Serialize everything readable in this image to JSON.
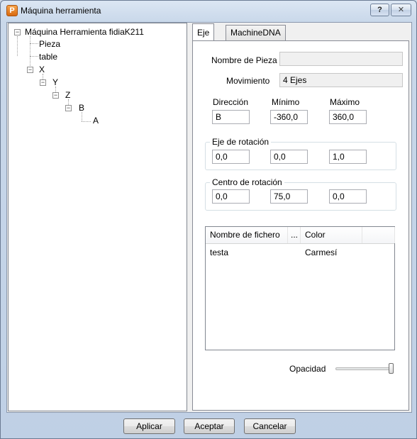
{
  "window": {
    "title": "Máquina herramienta",
    "icon": "app-p-icon",
    "help_label": "?",
    "close_label": "✕"
  },
  "tree": {
    "root": "Máquina Herramienta fidiaK211",
    "items": [
      "Pieza",
      "table",
      "X",
      "Y",
      "Z",
      "B",
      "A"
    ]
  },
  "tabs": [
    {
      "label": "Eje"
    },
    {
      "label": "MachineDNA"
    }
  ],
  "form": {
    "nombre_pieza_label": "Nombre de Pieza",
    "nombre_pieza_value": "",
    "movimiento_label": "Movimiento",
    "movimiento_value": "4 Ejes",
    "direccion_label": "Dirección",
    "minimo_label": "Mínimo",
    "maximo_label": "Máximo",
    "direccion_value": "B",
    "minimo_value": "-360,0",
    "maximo_value": "360,0",
    "eje_rotacion_title": "Eje de rotación",
    "eje_rotacion": [
      "0,0",
      "0,0",
      "1,0"
    ],
    "centro_rotacion_title": "Centro de rotación",
    "centro_rotacion": [
      "0,0",
      "75,0",
      "0,0"
    ]
  },
  "file_list": {
    "columns": [
      "Nombre de fichero",
      "...",
      "Color"
    ],
    "rows": [
      {
        "name": "testa",
        "color": "Carmesí"
      }
    ]
  },
  "opacity": {
    "label": "Opacidad",
    "value": 1.0
  },
  "buttons": {
    "apply": "Aplicar",
    "accept": "Aceptar",
    "cancel": "Cancelar"
  }
}
